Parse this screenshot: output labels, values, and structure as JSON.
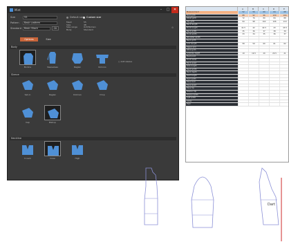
{
  "window": {
    "title": "Mint",
    "minimize": "–",
    "maximize": "□",
    "close": "✕"
  },
  "controls": {
    "rows": [
      {
        "label": "Size",
        "value": "55"
      },
      {
        "label": "Pattern",
        "value": "Basic pattern"
      },
      {
        "label": "Standard",
        "value": "Basic Block"
      }
    ],
    "ok_label": "OK",
    "radio_a": "Default size",
    "radio_b": "Custom size",
    "info_lines": [
      "Mesh",
      "Size",
      "Size range",
      "Body"
    ],
    "info_values": [
      "55",
      "48",
      "Oct/Women",
      "Standard"
    ]
  },
  "tabs": [
    {
      "label": "Options"
    },
    {
      "label": "Size"
    }
  ],
  "sections": [
    {
      "title": "Body",
      "items": [
        {
          "caption": "Bodice",
          "selected": true,
          "icon": "bodice-icon"
        },
        {
          "caption": "Sleeveless",
          "selected": false,
          "icon": "sleeveless-icon"
        },
        {
          "caption": "Raglan",
          "selected": false,
          "icon": "raglan-icon"
        },
        {
          "caption": "Kimono",
          "selected": false,
          "icon": "kimono-icon"
        }
      ],
      "extra_label": "Add sleeve"
    },
    {
      "title": "Sleeve",
      "items": [
        {
          "caption": "Set-in",
          "selected": false,
          "icon": "set-in-sleeve-icon"
        },
        {
          "caption": "Raglan",
          "selected": false,
          "icon": "raglan-sleeve-icon"
        },
        {
          "caption": "Dolman",
          "selected": false,
          "icon": "dolman-icon"
        },
        {
          "caption": "Drop",
          "selected": false,
          "icon": "drop-sleeve-icon"
        },
        {
          "caption": "Cap",
          "selected": false,
          "icon": "cap-sleeve-icon"
        },
        {
          "caption": "Bishop",
          "selected": true,
          "icon": "bishop-sleeve-icon"
        }
      ]
    },
    {
      "title": "Neckline",
      "items": [
        {
          "caption": "V-neck",
          "selected": false,
          "icon": "v-neck-icon"
        },
        {
          "caption": "Crew",
          "selected": true,
          "icon": "crew-neck-icon"
        },
        {
          "caption": "High",
          "selected": false,
          "icon": "high-neck-icon"
        }
      ]
    }
  ],
  "spreadsheet": {
    "headers": [
      "",
      "A",
      "B",
      "C",
      "D",
      "E"
    ],
    "rows": [
      {
        "name": "Measurement",
        "hl": true,
        "cells": [
          "52",
          "56",
          "60",
          "64",
          "68"
        ],
        "fill": "blue"
      },
      {
        "name": "Bust girth",
        "hl": false,
        "cells": [
          "88",
          "92",
          "96",
          "100",
          "104"
        ],
        "fill": "orange"
      },
      {
        "name": "Waist girth",
        "hl": false,
        "cells": [
          "72",
          "76",
          "80",
          "84",
          "88"
        ],
        "fill": ""
      },
      {
        "name": "Hip girth",
        "hl": false,
        "cells": [
          "94",
          "98",
          "102",
          "106",
          "110"
        ],
        "fill": ""
      },
      {
        "name": "Back length",
        "hl": false,
        "cells": [
          "",
          "",
          "",
          "",
          ""
        ],
        "fill": ""
      },
      {
        "name": "Front length",
        "hl": false,
        "cells": [
          "41.5",
          "42",
          "42.5",
          "43",
          "43.5"
        ],
        "fill": ""
      },
      {
        "name": "Back width",
        "hl": false,
        "cells": [
          "35",
          "36",
          "37",
          "38",
          "39"
        ],
        "fill": ""
      },
      {
        "name": "Front width",
        "hl": false,
        "cells": [
          "33",
          "34",
          "35",
          "36",
          "37"
        ],
        "fill": ""
      },
      {
        "name": "Shoulder width",
        "hl": false,
        "cells": [
          "",
          "",
          "",
          "",
          ""
        ],
        "fill": ""
      },
      {
        "name": "Neck girth",
        "hl": false,
        "cells": [
          "",
          "",
          "",
          "",
          ""
        ],
        "fill": ""
      },
      {
        "name": "Arm length",
        "hl": false,
        "cells": [
          "58",
          "59",
          "60",
          "61",
          "62"
        ],
        "fill": ""
      },
      {
        "name": "Upper arm",
        "hl": false,
        "cells": [
          "",
          "",
          "",
          "",
          ""
        ],
        "fill": ""
      },
      {
        "name": "Wrist girth",
        "hl": false,
        "cells": [
          "",
          "",
          "",
          "",
          ""
        ],
        "fill": ""
      },
      {
        "name": "Armhole depth",
        "hl": false,
        "cells": [
          "19",
          "19.5",
          "20",
          "20.5",
          "21"
        ],
        "fill": ""
      },
      {
        "name": "Bust point",
        "hl": false,
        "cells": [
          "",
          "",
          "",
          "",
          ""
        ],
        "fill": ""
      },
      {
        "name": "Front waist",
        "hl": false,
        "cells": [
          "",
          "",
          "",
          "",
          ""
        ],
        "fill": ""
      },
      {
        "name": "Back waist",
        "hl": false,
        "cells": [
          "",
          "",
          "",
          "",
          ""
        ],
        "fill": ""
      },
      {
        "name": "Side length",
        "hl": false,
        "cells": [
          "",
          "",
          "",
          "",
          ""
        ],
        "fill": ""
      },
      {
        "name": "Neck width",
        "hl": false,
        "cells": [
          "",
          "",
          "",
          "",
          ""
        ],
        "fill": ""
      },
      {
        "name": "Neck depth",
        "hl": false,
        "cells": [
          "",
          "",
          "",
          "",
          ""
        ],
        "fill": ""
      },
      {
        "name": "Dart length",
        "hl": false,
        "cells": [
          "",
          "",
          "",
          "",
          ""
        ],
        "fill": ""
      },
      {
        "name": "Dart width",
        "hl": false,
        "cells": [
          "",
          "",
          "",
          "",
          ""
        ],
        "fill": ""
      },
      {
        "name": "Ease bust",
        "hl": false,
        "cells": [
          "",
          "",
          "",
          "",
          ""
        ],
        "fill": ""
      },
      {
        "name": "Ease waist",
        "hl": false,
        "cells": [
          "",
          "",
          "",
          "",
          ""
        ],
        "fill": ""
      },
      {
        "name": "Ease hip",
        "hl": false,
        "cells": [
          "",
          "",
          "",
          "",
          ""
        ],
        "fill": ""
      },
      {
        "name": "Sleeve cap",
        "hl": false,
        "cells": [
          "",
          "",
          "",
          "",
          ""
        ],
        "fill": ""
      },
      {
        "name": "Sleeve width",
        "hl": false,
        "cells": [
          "",
          "",
          "",
          "",
          ""
        ],
        "fill": ""
      },
      {
        "name": "Cuff width",
        "hl": false,
        "cells": [
          "",
          "",
          "",
          "",
          ""
        ],
        "fill": ""
      },
      {
        "name": "Collar",
        "hl": false,
        "cells": [
          "",
          "",
          "",
          "",
          ""
        ],
        "fill": ""
      },
      {
        "name": "Hem",
        "hl": false,
        "cells": [
          "",
          "",
          "",
          "",
          ""
        ],
        "fill": ""
      }
    ]
  },
  "pattern": {
    "label": "Dart"
  },
  "colors": {
    "accent": "#c9653a",
    "garment_blue": "#4f90d6",
    "pattern_line": "#8a8fd6",
    "dart_line": "#cc2a2a"
  }
}
